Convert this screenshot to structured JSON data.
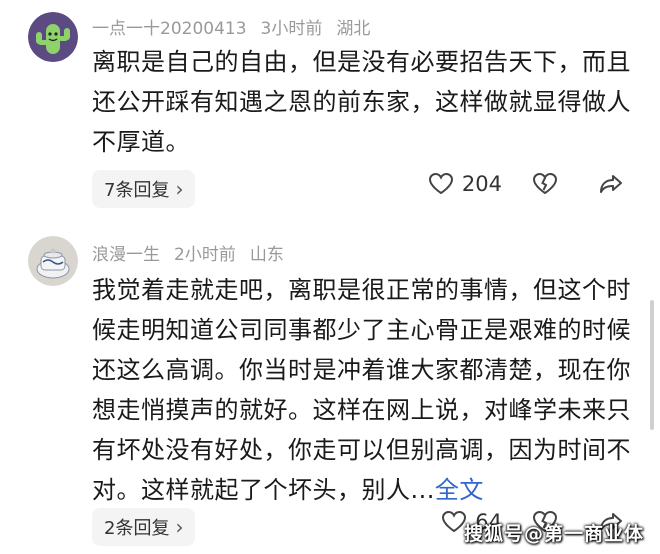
{
  "comments": [
    {
      "username": "一点一十20200413",
      "time": "3小时前",
      "location": "湖北",
      "text": "离职是自己的自由，但是没有必要招告天下，而且还公开踩有知遇之恩的前东家，这样做就显得做人不厚道。",
      "more_link": "",
      "replies_label": "7条回复",
      "likes": "204",
      "avatar_icon": "cactus-avatar"
    },
    {
      "username": "浪漫一生",
      "time": "2小时前",
      "location": "山东",
      "text": "我觉着走就走吧，离职是很正常的事情，但这个时候走明知道公司同事都少了主心骨正是艰难的时候还这么高调。你当时是冲着谁大家都清楚，现在你想走悄摸声的就好。这样在网上说，对峰学未来只有坏处没有好处，你走可以但别高调，因为时间不对。这样就起了个坏头，别人...",
      "more_link": "全文",
      "replies_label": "2条回复",
      "likes": "64",
      "avatar_icon": "porcelain-avatar"
    }
  ],
  "watermark": "搜狐号@第一商业体",
  "colors": {
    "meta_gray": "#9a9a9a",
    "link_blue": "#3366cc",
    "reply_bg": "#f4f4f4"
  }
}
